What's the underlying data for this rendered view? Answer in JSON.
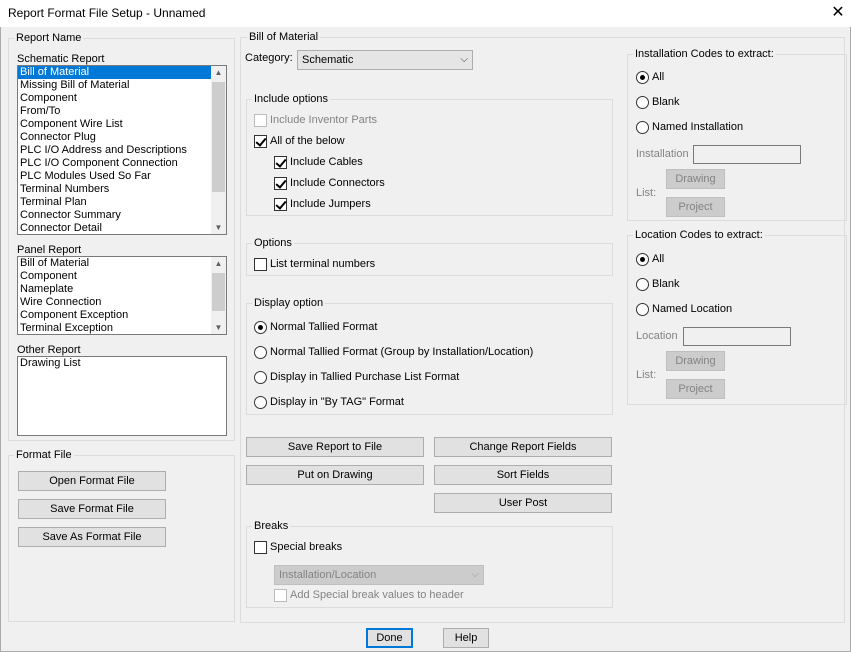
{
  "window": {
    "title": "Report Format File Setup - Unnamed",
    "close_label": "✕"
  },
  "report_name": {
    "group_label": "Report Name",
    "schematic": {
      "label": "Schematic Report",
      "items": [
        "Bill of Material",
        "Missing Bill of Material",
        "Component",
        "From/To",
        "Component Wire List",
        "Connector Plug",
        "PLC I/O Address and Descriptions",
        "PLC I/O Component Connection",
        "PLC Modules Used So Far",
        "Terminal Numbers",
        "Terminal Plan",
        "Connector Summary",
        "Connector Detail"
      ],
      "selected_index": 0
    },
    "panel": {
      "label": "Panel Report",
      "items": [
        "Bill of Material",
        "Component",
        "Nameplate",
        "Wire Connection",
        "Component Exception",
        "Terminal Exception"
      ]
    },
    "other": {
      "label": "Other Report",
      "items": [
        "Drawing List"
      ]
    }
  },
  "format_file": {
    "group_label": "Format File",
    "open_label": "Open Format File",
    "save_label": "Save Format File",
    "save_as_label": "Save As Format File"
  },
  "main": {
    "section_title": "Bill of Material",
    "category_label": "Category:",
    "category_value": "Schematic",
    "include_options": {
      "label": "Include options",
      "inventor_parts": "Include Inventor Parts",
      "all_below": "All of the below",
      "cables": "Include Cables",
      "connectors": "Include Connectors",
      "jumpers": "Include Jumpers"
    },
    "options": {
      "label": "Options",
      "list_terminal_numbers": "List terminal numbers"
    },
    "display_option": {
      "label": "Display option",
      "items": [
        "Normal Tallied Format",
        "Normal Tallied Format (Group by Installation/Location)",
        "Display in Tallied Purchase List Format",
        "Display in \"By TAG\" Format"
      ],
      "selected_index": 0
    },
    "buttons": {
      "save_report": "Save Report to File",
      "change_fields": "Change Report Fields",
      "put_on_drawing": "Put on Drawing",
      "sort_fields": "Sort Fields",
      "user_post": "User Post"
    },
    "breaks": {
      "label": "Breaks",
      "special_breaks": "Special breaks",
      "combo_value": "Installation/Location",
      "add_values": "Add Special break values to header"
    }
  },
  "installation": {
    "label": "Installation Codes to extract:",
    "all": "All",
    "blank": "Blank",
    "named": "Named Installation",
    "field_label": "Installation",
    "list_label": "List:",
    "drawing": "Drawing",
    "project": "Project"
  },
  "location": {
    "label": "Location Codes to extract:",
    "all": "All",
    "blank": "Blank",
    "named": "Named Location",
    "field_label": "Location",
    "list_label": "List:",
    "drawing": "Drawing",
    "project": "Project"
  },
  "footer": {
    "done": "Done",
    "help": "Help"
  }
}
